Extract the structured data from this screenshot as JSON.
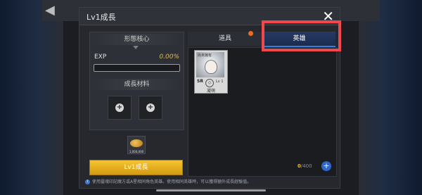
{
  "dialog": {
    "title": "Lv1成長",
    "close_glyph": "✕"
  },
  "left": {
    "core_label": "形態核心",
    "exp_label": "EXP",
    "exp_percent": "0.00%",
    "exp_progress": 0,
    "materials_label": "成長材料",
    "slot_plus": "+",
    "gold_count": "1,000,000",
    "levelup_button": "Lv1成長"
  },
  "right": {
    "tab_items": "道具",
    "tab_heroes": "英雄",
    "card": {
      "top_text": "尚未擁有",
      "rank": "SR",
      "level": "Lv 1",
      "mark": "◇",
      "name": "凝萌"
    },
    "count_current": "0",
    "count_max": "/400",
    "add_button": "+"
  },
  "info_text": "使用靈魂印記魔方或A星相同角色英雄。使用相同英雄時，可以獲得額外成長經驗值。",
  "colors": {
    "accent": "#f0b93c",
    "highlight_box": "#f0484d",
    "tab_active": "#273a63",
    "notification_dot": "#f26a1e"
  },
  "icons": {
    "back": "back-arrow-icon",
    "close": "close-icon",
    "info": "info-icon",
    "gold": "gold-coin-icon"
  }
}
